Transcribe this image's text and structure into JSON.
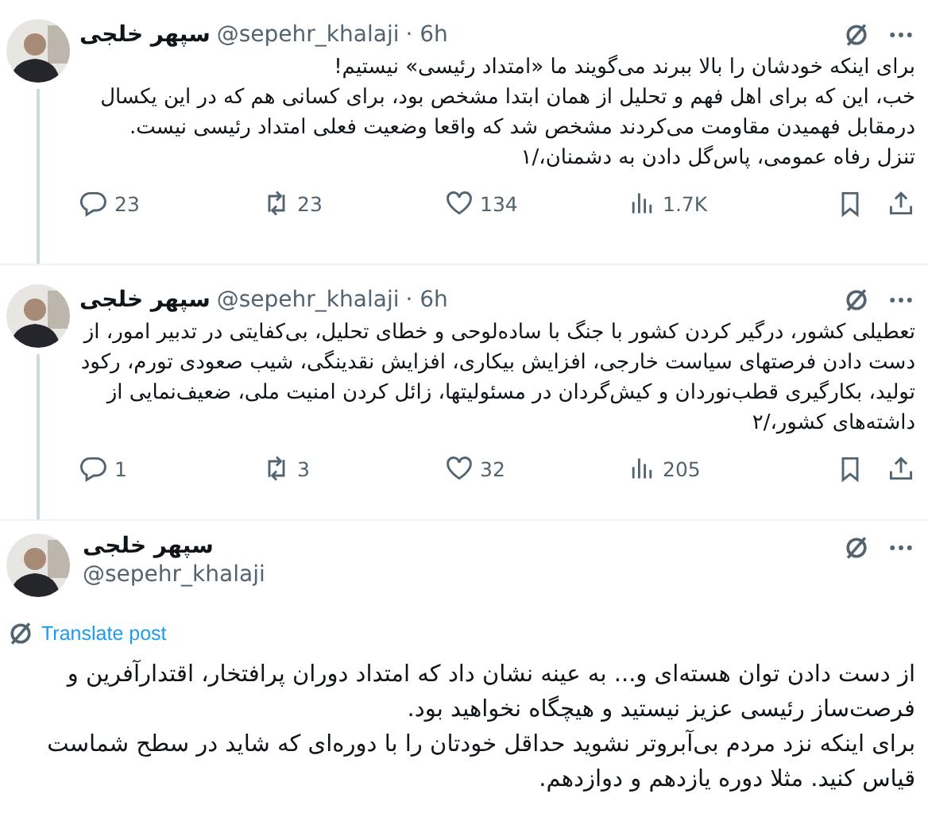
{
  "posts": [
    {
      "kind": "reply",
      "author": "سپهر خلجی",
      "handle": "@sepehr_khalaji",
      "time": "· 6h",
      "paragraphs": [
        "برای اینکه خودشان را بالا ببرند می‌گویند ما «امتداد رئیسی» نیستیم!",
        "خب، این که برای اهل فهم و تحلیل از همان ابتدا مشخص بود، برای کسانی هم که در این یکسال  درمقابل فهمیدن مقاومت می‌کردند مشخص شد که واقعا وضعیت فعلی امتداد رئیسی نیست.",
        "تنزل رفاه عمومی، پاس‌گل دادن به دشمنان،/۱"
      ],
      "stats": {
        "replies": "23",
        "reposts": "23",
        "likes": "134",
        "views": "1.7K"
      }
    },
    {
      "kind": "reply",
      "author": "سپهر خلجی",
      "handle": "@sepehr_khalaji",
      "time": "· 6h",
      "paragraphs": [
        "تعطیلی کشور، درگیر کردن کشور با جنگ با ساده‌لوحی و خطای تحلیل، بی‌کفایتی در تدبیر امور، از دست دادن فرصتهای سیاست خارجی، افزایش بیکاری، افزایش نقدینگی، شیب صعودی تورم، رکود تولید، بکارگیری قطب‌نوردان و کیش‌گردان در مسئولیتها، زائل کردن امنیت ملی، ضعیف‌نمایی از داشته‌های کشور،/۲"
      ],
      "stats": {
        "replies": "1",
        "reposts": "3",
        "likes": "32",
        "views": "205"
      }
    },
    {
      "kind": "focused",
      "author": "سپهر خلجی",
      "handle": "@sepehr_khalaji",
      "translate": "Translate post",
      "paragraphs": [
        "از دست دادن توان هسته‌ای و... به عینه نشان داد که امتداد دوران پرافتخار، اقتدارآفرین و فرصت‌ساز رئیسی عزیز نیستید و هیچگاه نخواهید بود.",
        "برای اینکه نزد مردم بی‌آبروتر نشوید حداقل خودتان را با دوره‌ای که شاید در سطح شماست قیاس کنید. مثلا دوره یازدهم و دوازدهم."
      ]
    }
  ]
}
